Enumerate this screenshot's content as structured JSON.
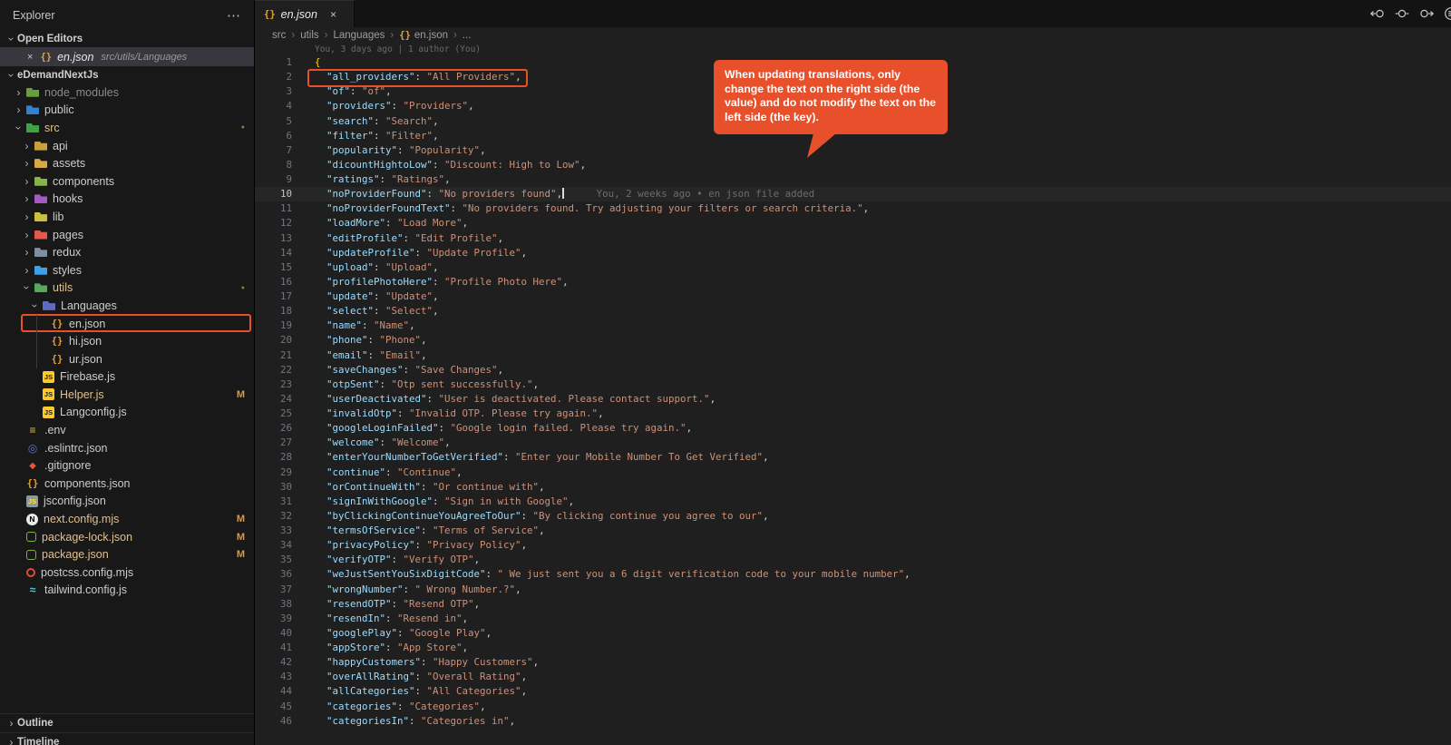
{
  "icons": {
    "more": "⋯",
    "close": "×",
    "json_braces": "{}",
    "chevron": "›",
    "breadcrumb_sep": "›",
    "modified_dot": "●",
    "glyphs": {
      "json": "{}",
      "js": "JS",
      "jsgray": "JS",
      "env": "≡",
      "eslint": "◎",
      "git": "◆",
      "next": "N",
      "npm": "",
      "postcss": "",
      "tailwind": "≈"
    },
    "editor_actions": [
      "previous-change-icon",
      "open-changes-icon",
      "next-change-icon",
      "editor-overflow-icon"
    ]
  },
  "colors": {
    "accent_red": "#e8502c",
    "key": "#9cdcfe",
    "value": "#ce9178",
    "brace": "#ffd700",
    "modified": "#e2c08d",
    "sidebar_bg": "#181818",
    "editor_bg": "#1f1f1f"
  },
  "sidebar": {
    "title": "Explorer",
    "open_editors": {
      "header": "Open Editors",
      "items": [
        {
          "name": "en.json",
          "path": "src/utils/Languages",
          "selected": true
        }
      ]
    },
    "project": {
      "header": "eDemandNextJs",
      "tree": [
        {
          "label": "node_modules",
          "kind": "folder",
          "icon": "folder",
          "color": "#699e3c",
          "level": 1,
          "dim": true
        },
        {
          "label": "public",
          "kind": "folder",
          "icon": "folder",
          "color": "#2f81d6",
          "level": 1
        },
        {
          "label": "src",
          "kind": "folder",
          "icon": "folder",
          "color": "#3fa344",
          "level": 1,
          "expanded": true,
          "modified": true,
          "dot": true
        },
        {
          "label": "api",
          "kind": "folder",
          "icon": "folder",
          "color": "#c9a13b",
          "level": 2
        },
        {
          "label": "assets",
          "kind": "folder",
          "icon": "folder",
          "color": "#d9a648",
          "level": 2
        },
        {
          "label": "components",
          "kind": "folder",
          "icon": "folder",
          "color": "#86b44a",
          "level": 2
        },
        {
          "label": "hooks",
          "kind": "folder",
          "icon": "folder",
          "color": "#a45cc2",
          "level": 2
        },
        {
          "label": "lib",
          "kind": "folder",
          "icon": "folder",
          "color": "#cbbf3f",
          "level": 2
        },
        {
          "label": "pages",
          "kind": "folder",
          "icon": "folder",
          "color": "#e05a4e",
          "level": 2
        },
        {
          "label": "redux",
          "kind": "folder",
          "icon": "folder",
          "color": "#7d8fa0",
          "level": 2
        },
        {
          "label": "styles",
          "kind": "folder",
          "icon": "folder",
          "color": "#3fa0e8",
          "level": 2
        },
        {
          "label": "utils",
          "kind": "folder",
          "icon": "folder",
          "color": "#58a85c",
          "level": 2,
          "expanded": true,
          "modified": true,
          "dot": true
        },
        {
          "label": "Languages",
          "kind": "folder",
          "icon": "folder",
          "color": "#5d6cc0",
          "level": 3,
          "expanded": true
        },
        {
          "label": "en.json",
          "kind": "file",
          "icon": "json",
          "level": 4,
          "highlighted": true
        },
        {
          "label": "hi.json",
          "kind": "file",
          "icon": "json",
          "level": 4
        },
        {
          "label": "ur.json",
          "kind": "file",
          "icon": "json",
          "level": 4
        },
        {
          "label": "Firebase.js",
          "kind": "file",
          "icon": "js",
          "level": 3
        },
        {
          "label": "Helper.js",
          "kind": "file",
          "icon": "js",
          "level": 3,
          "modified": true,
          "badge": "M"
        },
        {
          "label": "Langconfig.js",
          "kind": "file",
          "icon": "js",
          "level": 3
        },
        {
          "label": ".env",
          "kind": "file",
          "icon": "env",
          "level": 1
        },
        {
          "label": ".eslintrc.json",
          "kind": "file",
          "icon": "eslint",
          "level": 1
        },
        {
          "label": ".gitignore",
          "kind": "file",
          "icon": "git",
          "level": 1
        },
        {
          "label": "components.json",
          "kind": "file",
          "icon": "json",
          "level": 1
        },
        {
          "label": "jsconfig.json",
          "kind": "file",
          "icon": "jsgray",
          "level": 1
        },
        {
          "label": "next.config.mjs",
          "kind": "file",
          "icon": "next",
          "level": 1,
          "modified": true,
          "badge": "M"
        },
        {
          "label": "package-lock.json",
          "kind": "file",
          "icon": "npm",
          "level": 1,
          "modified": true,
          "badge": "M"
        },
        {
          "label": "package.json",
          "kind": "file",
          "icon": "npm",
          "level": 1,
          "modified": true,
          "badge": "M"
        },
        {
          "label": "postcss.config.mjs",
          "kind": "file",
          "icon": "postcss",
          "level": 1
        },
        {
          "label": "tailwind.config.js",
          "kind": "file",
          "icon": "tailwind",
          "level": 1
        }
      ]
    },
    "bottom": [
      {
        "label": "Outline"
      },
      {
        "label": "Timeline"
      }
    ]
  },
  "editor": {
    "tab": {
      "title": "en.json"
    },
    "breadcrumb": [
      {
        "label": "src"
      },
      {
        "label": "utils"
      },
      {
        "label": "Languages"
      },
      {
        "label": "en.json",
        "icon": "json"
      },
      {
        "label": "..."
      }
    ],
    "file_annotation": "You, 3 days ago | 1 author (You)",
    "open_brace": "{",
    "current_line": 10,
    "boxed_line": 2,
    "blame_text": "You, 2 weeks ago • en json file added",
    "translations": [
      [
        "all_providers",
        "All Providers"
      ],
      [
        "of",
        "of"
      ],
      [
        "providers",
        "Providers"
      ],
      [
        "search",
        "Search"
      ],
      [
        "filter",
        "Filter"
      ],
      [
        "popularity",
        "Popularity"
      ],
      [
        "dicountHightoLow",
        "Discount: High to Low"
      ],
      [
        "ratings",
        "Ratings"
      ],
      [
        "noProviderFound",
        "No providers found"
      ],
      [
        "noProviderFoundText",
        "No providers found. Try adjusting your filters or search criteria."
      ],
      [
        "loadMore",
        "Load More"
      ],
      [
        "editProfile",
        "Edit Profile"
      ],
      [
        "updateProfile",
        "Update Profile"
      ],
      [
        "upload",
        "Upload"
      ],
      [
        "profilePhotoHere",
        "Profile Photo Here"
      ],
      [
        "update",
        "Update"
      ],
      [
        "select",
        "Select"
      ],
      [
        "name",
        "Name"
      ],
      [
        "phone",
        "Phone"
      ],
      [
        "email",
        "Email"
      ],
      [
        "saveChanges",
        "Save Changes"
      ],
      [
        "otpSent",
        "Otp sent successfully."
      ],
      [
        "userDeactivated",
        "User is deactivated. Please contact support."
      ],
      [
        "invalidOtp",
        "Invalid OTP. Please try again."
      ],
      [
        "googleLoginFailed",
        "Google login failed. Please try again."
      ],
      [
        "welcome",
        "Welcome"
      ],
      [
        "enterYourNumberToGetVerified",
        "Enter your Mobile Number To Get Verified"
      ],
      [
        "continue",
        "Continue"
      ],
      [
        "orContinueWith",
        "Or continue with"
      ],
      [
        "signInWithGoogle",
        "Sign in with Google"
      ],
      [
        "byClickingContinueYouAgreeToOur",
        "By clicking continue you agree to our"
      ],
      [
        "termsOfService",
        "Terms of Service"
      ],
      [
        "privacyPolicy",
        "Privacy Policy"
      ],
      [
        "verifyOTP",
        "Verify OTP"
      ],
      [
        "weJustSentYouSixDigitCode",
        " We just sent you a 6 digit verification code to your mobile number"
      ],
      [
        "wrongNumber",
        " Wrong Number.?"
      ],
      [
        "resendOTP",
        "Resend OTP"
      ],
      [
        "resendIn",
        "Resend in"
      ],
      [
        "googlePlay",
        "Google Play"
      ],
      [
        "appStore",
        "App Store"
      ],
      [
        "happyCustomers",
        "Happy Customers"
      ],
      [
        "overAllRating",
        "Overall Rating"
      ],
      [
        "allCategories",
        "All Categories"
      ],
      [
        "categories",
        "Categories"
      ],
      [
        "categoriesIn",
        "Categories in"
      ]
    ]
  },
  "callout": {
    "text": "When updating translations, only change the text on the right side (the value) and do not modify the text on the left side (the key)."
  }
}
